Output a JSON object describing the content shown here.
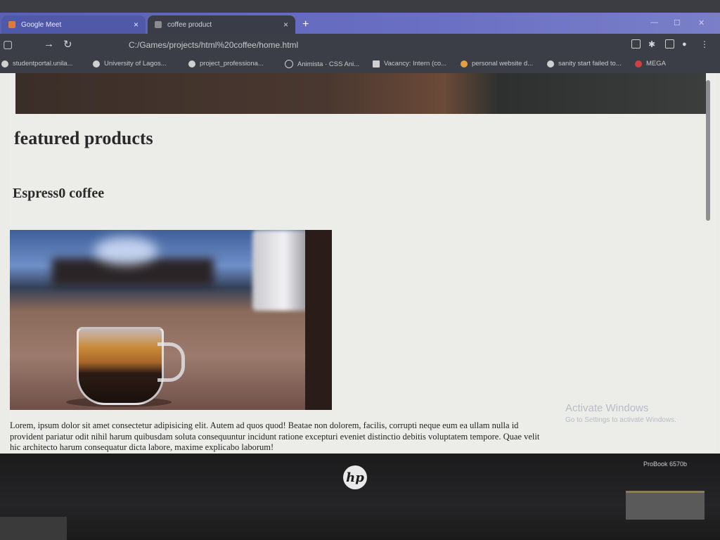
{
  "browser": {
    "tabs": [
      {
        "label": "Google Meet"
      },
      {
        "label": "coffee product"
      }
    ],
    "new_tab_glyph": "+",
    "address": "C:/Games/projects/html%20coffee/home.html",
    "bookmarks": [
      {
        "label": "studentportal.unila..."
      },
      {
        "label": "University of Lagos..."
      },
      {
        "label": "project_professiona..."
      },
      {
        "label": "Animista · CSS Ani..."
      },
      {
        "label": "Vacancy: Intern (co..."
      },
      {
        "label": "personal website d..."
      },
      {
        "label": "sanity start failed to..."
      },
      {
        "label": "MEGA"
      }
    ]
  },
  "page": {
    "heading": "featured products",
    "product": {
      "title": "Espress0 coffee",
      "description": "Lorem, ipsum dolor sit amet consectetur adipisicing elit. Autem ad quos quod! Beatae non dolorem, facilis, corrupti neque eum ea ullam nulla id provident pariatur odit nihil harum quibusdam soluta consequuntur incidunt ratione excepturi eveniet distinctio debitis voluptatem tempore. Quae velit hic architecto harum consequatur dicta labore, maxime explicabo laborum!"
    }
  },
  "os": {
    "watermark_title": "Activate Windows",
    "watermark_sub": "Go to Settings to activate Windows."
  },
  "device": {
    "brand": "hp",
    "model": "ProBook 6570b"
  },
  "colors": {
    "tab_bar": "#6a6fc4",
    "toolbar": "#3b3e47",
    "page_bg": "#ecece8"
  }
}
